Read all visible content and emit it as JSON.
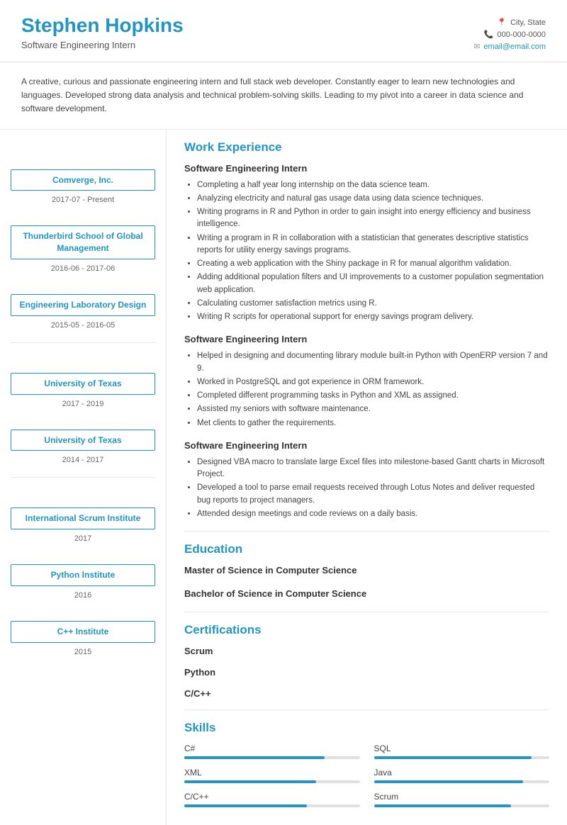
{
  "header": {
    "name": "Stephen Hopkins",
    "title": "Software Engineering Intern",
    "location": "City, State",
    "phone": "000-000-0000",
    "email": "email@email.com"
  },
  "summary": "A creative, curious and passionate engineering intern and full stack web developer. Constantly eager to learn new technologies and languages. Developed strong data analysis and technical problem-solving skills. Leading to my pivot into a career in data science and software development.",
  "sections": {
    "work_experience_label": "Work Experience",
    "education_label": "Education",
    "certifications_label": "Certifications",
    "skills_label": "Skills"
  },
  "work_experience": [
    {
      "company": "Comverge, Inc.",
      "date": "2017-07 - Present",
      "job_title": "Software Engineering Intern",
      "bullets": [
        "Completing a half year long internship on the data science team.",
        "Analyzing electricity and natural gas usage data using data science techniques.",
        "Writing programs in R and Python in order to gain insight into energy efficiency and business intelligence.",
        "Writing a program in R in collaboration with a statistician that generates descriptive statistics reports for utility energy savings programs.",
        "Creating a web application with the Shiny package in R for manual algorithm validation.",
        "Adding additional population filters and UI improvements to a customer population segmentation web application.",
        "Calculating customer satisfaction metrics using R.",
        "Writing R scripts for operational support for energy savings program delivery."
      ]
    },
    {
      "company": "Thunderbird School of Global Management",
      "date": "2016-06 - 2017-06",
      "job_title": "Software Engineering Intern",
      "bullets": [
        "Helped in designing and documenting library module built-in Python with OpenERP version 7 and 9.",
        "Worked in PostgreSQL and got experience in ORM framework.",
        "Completed different programming tasks in Python and XML as assigned.",
        "Assisted my seniors with software maintenance.",
        "Met clients to gather the requirements."
      ]
    },
    {
      "company": "Engineering Laboratory Design",
      "date": "2015-05 - 2016-05",
      "job_title": "Software Engineering Intern",
      "bullets": [
        "Designed VBA macro to translate large Excel files into milestone-based Gantt charts in Microsoft Project.",
        "Developed a tool to parse email requests received through Lotus Notes and deliver requested bug reports to project managers.",
        "Attended design meetings and code reviews on a daily basis."
      ]
    }
  ],
  "education": [
    {
      "institution": "University of Texas",
      "date": "2017 - 2019",
      "degree": "Master of Science in Computer Science"
    },
    {
      "institution": "University of Texas",
      "date": "2014 - 2017",
      "degree": "Bachelor of Science in Computer Science"
    }
  ],
  "certifications": [
    {
      "institution": "International Scrum Institute",
      "date": "2017",
      "name": "Scrum"
    },
    {
      "institution": "Python Institute",
      "date": "2016",
      "name": "Python"
    },
    {
      "institution": "C++ Institute",
      "date": "2015",
      "name": "C/C++"
    }
  ],
  "skills": [
    {
      "name": "C#",
      "level": 80
    },
    {
      "name": "SQL",
      "level": 90
    },
    {
      "name": "XML",
      "level": 75
    },
    {
      "name": "Java",
      "level": 85
    },
    {
      "name": "C/C++",
      "level": 70
    },
    {
      "name": "Scrum",
      "level": 78
    }
  ]
}
